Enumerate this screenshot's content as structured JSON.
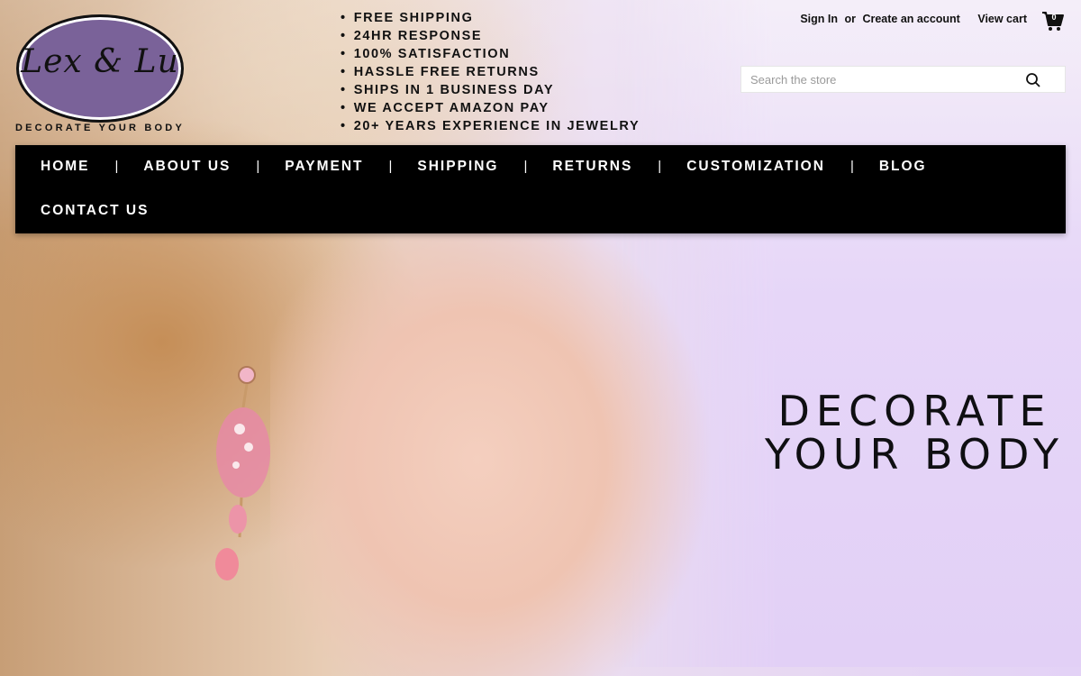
{
  "logo": {
    "text": "Lex & Lu",
    "tagline": "DECORATE YOUR BODY"
  },
  "perks": [
    "FREE SHIPPING",
    "24HR RESPONSE",
    "100% SATISFACTION",
    "HASSLE FREE RETURNS",
    "SHIPS IN 1 BUSINESS DAY",
    "WE ACCEPT AMAZON PAY",
    "20+ YEARS EXPERIENCE IN JEWELRY"
  ],
  "account": {
    "sign_in": "Sign In",
    "or": "or",
    "create": "Create an account",
    "view_cart": "View cart",
    "cart_count": "0"
  },
  "search": {
    "placeholder": "Search the store"
  },
  "nav": {
    "items": [
      "HOME",
      "ABOUT US",
      "PAYMENT",
      "SHIPPING",
      "RETURNS",
      "CUSTOMIZATION",
      "BLOG",
      "CONTACT US"
    ],
    "separator": "|"
  },
  "hero": {
    "line1": "DECORATE",
    "line2": "YOUR BODY"
  },
  "colors": {
    "logo_oval": "#7a6299",
    "nav_bg": "#000000",
    "hero_bg": "#e2d0f6"
  }
}
